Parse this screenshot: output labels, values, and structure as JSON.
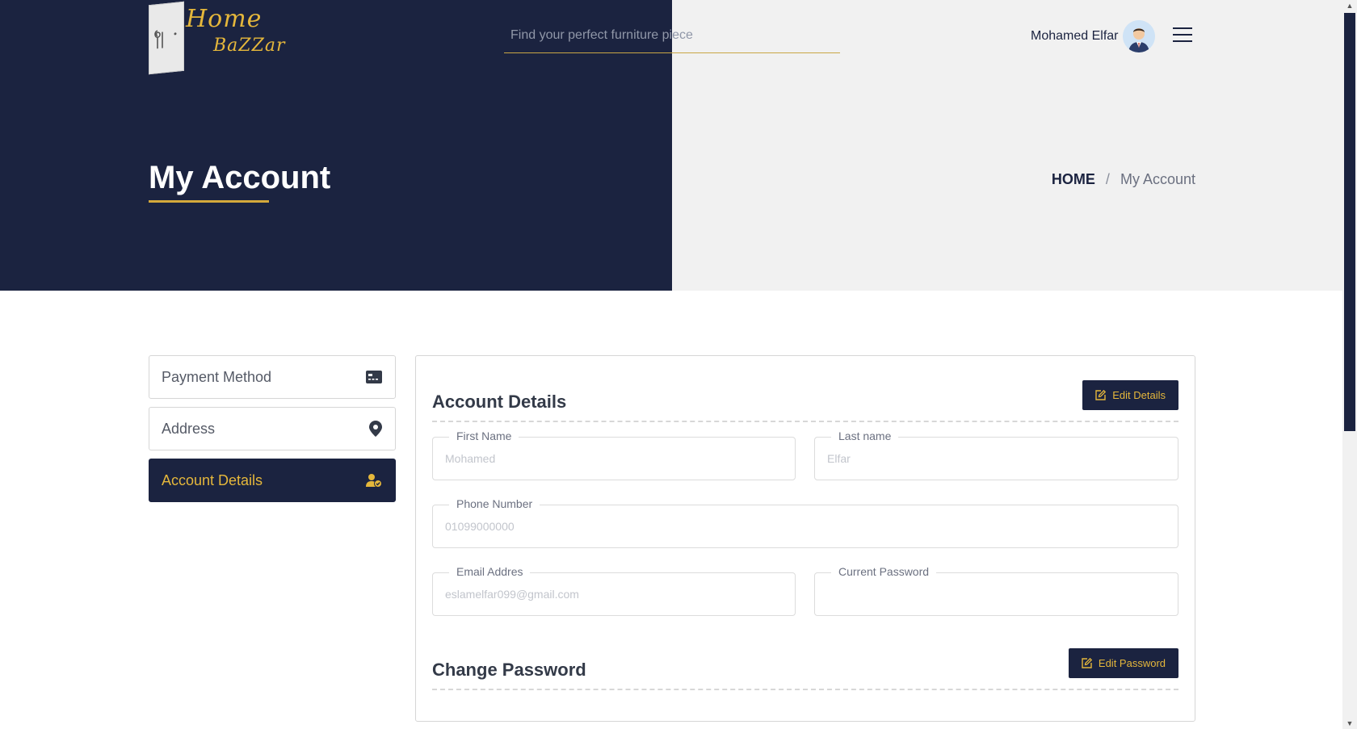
{
  "brand": {
    "line1": "Home",
    "line2": "BaZZar"
  },
  "search": {
    "placeholder": "Find your perfect furniture piece"
  },
  "user": {
    "name": "Mohamed  Elfar"
  },
  "hero": {
    "title": "My Account"
  },
  "breadcrumb": {
    "home": "HOME",
    "separator": "/",
    "current": "My Account"
  },
  "sidebar": {
    "items": [
      {
        "label": "Payment Method",
        "icon": "credit-card-icon"
      },
      {
        "label": "Address",
        "icon": "map-pin-icon"
      },
      {
        "label": "Account Details",
        "icon": "user-check-icon",
        "active": true
      }
    ]
  },
  "account": {
    "title": "Account Details",
    "edit_label": "Edit Details",
    "fields": {
      "first_name": {
        "label": "First Name",
        "placeholder": "Mohamed"
      },
      "last_name": {
        "label": "Last name",
        "placeholder": "Elfar"
      },
      "phone": {
        "label": "Phone Number",
        "placeholder": "01099000000"
      },
      "email": {
        "label": "Email Addres",
        "placeholder": "eslamelfar099@gmail.com"
      },
      "current_password": {
        "label": "Current Password",
        "placeholder": ""
      }
    }
  },
  "password": {
    "title": "Change Password",
    "edit_label": "Edit Password"
  },
  "colors": {
    "navy": "#1b2340",
    "gold": "#e5b73b",
    "light_bg": "#f1f1f1"
  }
}
